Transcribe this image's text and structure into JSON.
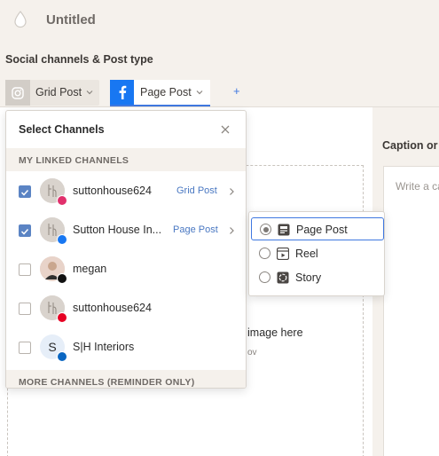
{
  "app": {
    "title": "Untitled"
  },
  "social": {
    "section_title": "Social channels & Post type",
    "tabs": [
      {
        "label": "Grid Post",
        "icon": "instagram-icon"
      },
      {
        "label": "Page Post",
        "icon": "facebook-icon"
      }
    ],
    "add_label": "+"
  },
  "dropdown": {
    "title": "Select Channels",
    "linked_header": "MY LINKED CHANNELS",
    "more_header": "MORE CHANNELS (REMINDER ONLY)",
    "channels": [
      {
        "name": "suttonhouse624",
        "type": "Grid Post",
        "checked": true,
        "network": "instagram",
        "badge_color": "#e1306c",
        "avatar_initial": ""
      },
      {
        "name": "Sutton House In...",
        "type": "Page Post",
        "checked": true,
        "network": "facebook",
        "badge_color": "#1877f2",
        "avatar_initial": ""
      },
      {
        "name": "megan",
        "type": "",
        "checked": false,
        "network": "tiktok",
        "badge_color": "#111111",
        "avatar_initial": ""
      },
      {
        "name": "suttonhouse624",
        "type": "",
        "checked": false,
        "network": "pinterest",
        "badge_color": "#e60023",
        "avatar_initial": ""
      },
      {
        "name": "S|H Interiors",
        "type": "",
        "checked": false,
        "network": "linkedin",
        "badge_color": "#0a66c2",
        "avatar_initial": "S"
      }
    ]
  },
  "post_type_menu": {
    "options": [
      {
        "label": "Page Post",
        "selected": true,
        "icon": "page-post-icon"
      },
      {
        "label": "Reel",
        "selected": false,
        "icon": "reel-icon"
      },
      {
        "label": "Story",
        "selected": false,
        "icon": "story-icon"
      }
    ]
  },
  "editor": {
    "drop_text": "image here",
    "drop_subtext": "ov"
  },
  "caption": {
    "title": "Caption or D",
    "placeholder": "Write a ca"
  },
  "colors": {
    "accent": "#3f78e0",
    "checkbox": "#5b84c4",
    "background": "#f5f1ec"
  }
}
